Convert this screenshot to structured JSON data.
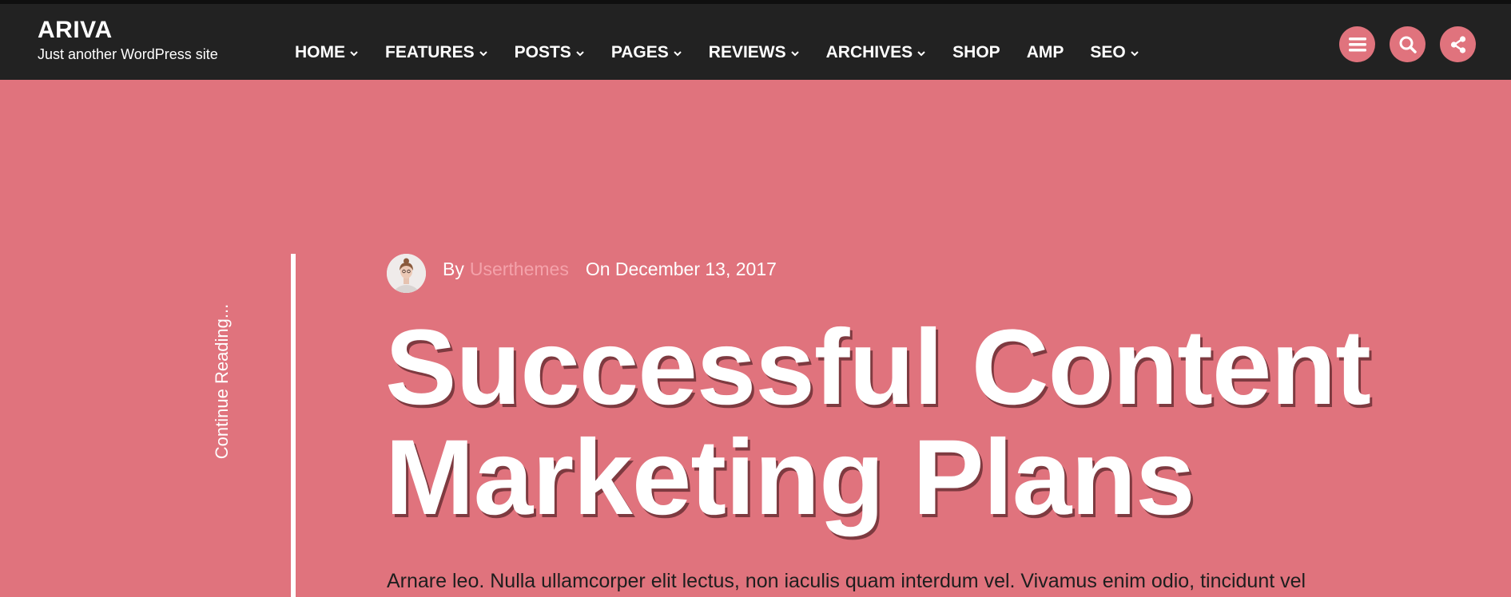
{
  "site": {
    "title": "ARIVA",
    "tagline": "Just another WordPress site"
  },
  "nav": {
    "items": [
      {
        "label": "HOME",
        "has_dropdown": true
      },
      {
        "label": "FEATURES",
        "has_dropdown": true
      },
      {
        "label": "POSTS",
        "has_dropdown": true
      },
      {
        "label": "PAGES",
        "has_dropdown": true
      },
      {
        "label": "REVIEWS",
        "has_dropdown": true
      },
      {
        "label": "ARCHIVES",
        "has_dropdown": true
      },
      {
        "label": "SHOP",
        "has_dropdown": false
      },
      {
        "label": "AMP",
        "has_dropdown": false
      },
      {
        "label": "SEO",
        "has_dropdown": true
      }
    ]
  },
  "header_icons": [
    "menu-icon",
    "search-icon",
    "share-icon"
  ],
  "post": {
    "continue_label": "Continue Reading...",
    "by_label": "By",
    "author": "Userthemes",
    "date": "On December 13, 2017",
    "title": "Successful Content Marketing Plans",
    "excerpt": "Arnare leo. Nulla ullamcorper elit lectus, non iaculis quam interdum vel. Vivamus enim odio, tincidunt vel"
  },
  "colors": {
    "header_bg": "#222222",
    "hero_bg": "#e0737d",
    "accent": "#e0737d",
    "author_link": "#f4a2aa",
    "title_shadow": "#7e3a40"
  }
}
